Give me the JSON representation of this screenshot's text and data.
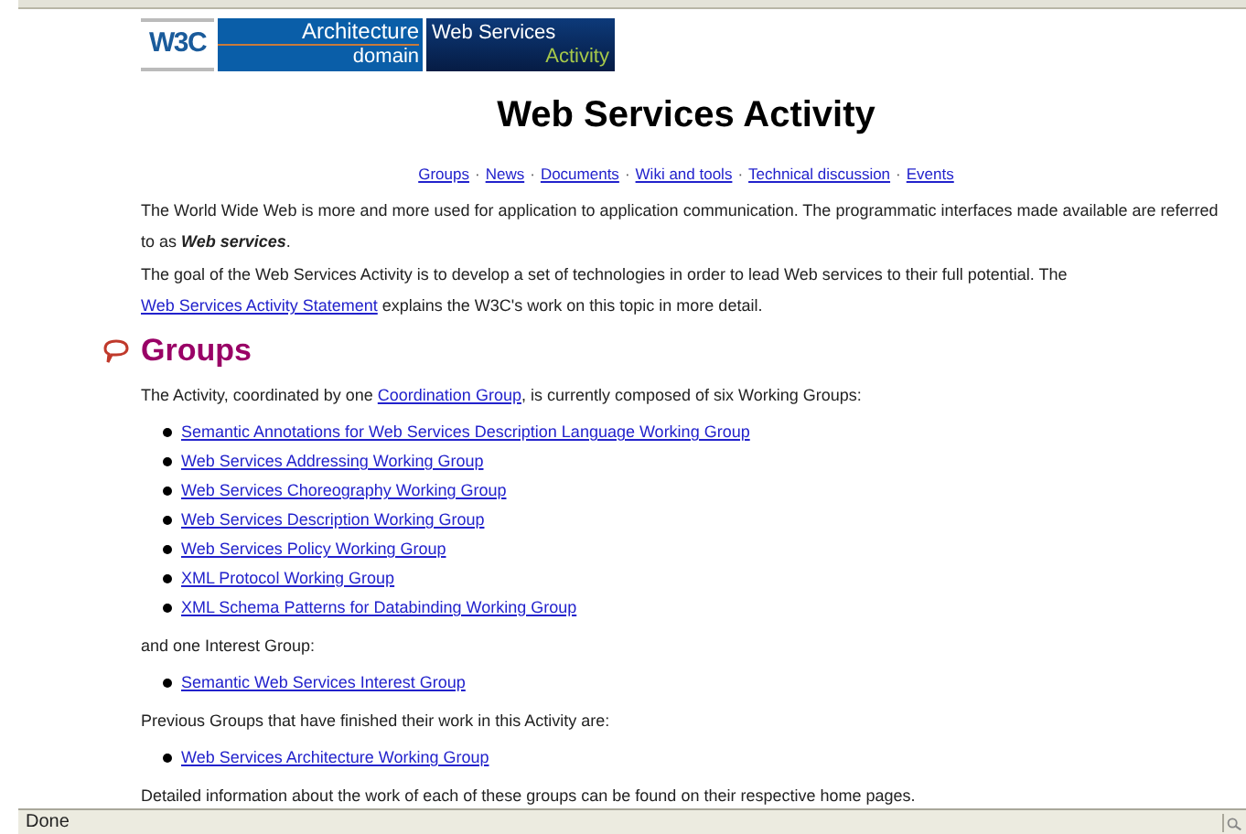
{
  "banner": {
    "logo": "W3C",
    "domain_top": "Architecture",
    "domain_bottom": "domain",
    "activity_top": "Web Services",
    "activity_bottom": "Activity"
  },
  "title": "Web Services Activity",
  "nav": [
    "Groups",
    "News",
    "Documents",
    "Wiki and tools",
    "Technical discussion",
    "Events"
  ],
  "nav_separator": "·",
  "intro": [
    [
      {
        "kind": "text",
        "text": "The World Wide Web is more and more used for application to application communication. The programmatic interfaces made available are referred to as "
      },
      {
        "kind": "strong",
        "text": "Web services"
      },
      {
        "kind": "text",
        "text": "."
      }
    ],
    [
      {
        "kind": "text",
        "text": "The goal of the Web Services Activity is to develop a set of technologies in order to lead Web services to their full potential. The "
      },
      {
        "kind": "link",
        "text": "Web Services Activity Statement"
      },
      {
        "kind": "text",
        "text": " explains the W3C's work on this topic in more detail."
      }
    ]
  ],
  "section": {
    "heading": "Groups",
    "blocks": [
      {
        "kind": "para",
        "parts": [
          {
            "kind": "text",
            "text": "The Activity, coordinated by one "
          },
          {
            "kind": "link",
            "text": "Coordination Group"
          },
          {
            "kind": "text",
            "text": ", is currently composed of six Working Groups:"
          }
        ]
      },
      {
        "kind": "list",
        "items": [
          "Semantic Annotations for Web Services Description Language Working Group",
          "Web Services Addressing Working Group",
          "Web Services Choreography Working Group",
          "Web Services Description Working Group",
          "Web Services Policy Working Group",
          "XML Protocol Working Group",
          "XML Schema Patterns for Databinding Working Group"
        ]
      },
      {
        "kind": "para",
        "parts": [
          {
            "kind": "text",
            "text": "and one Interest Group:"
          }
        ]
      },
      {
        "kind": "list",
        "items": [
          "Semantic Web Services Interest Group"
        ]
      },
      {
        "kind": "para",
        "parts": [
          {
            "kind": "text",
            "text": "Previous Groups that have finished their work in this Activity are:"
          }
        ]
      },
      {
        "kind": "list",
        "items": [
          "Web Services Architecture Working Group"
        ]
      },
      {
        "kind": "para",
        "parts": [
          {
            "kind": "text",
            "text": "Detailed information about the work of each of these groups can be found on their respective home pages."
          }
        ]
      }
    ]
  },
  "status_bar": {
    "text": "Done"
  }
}
